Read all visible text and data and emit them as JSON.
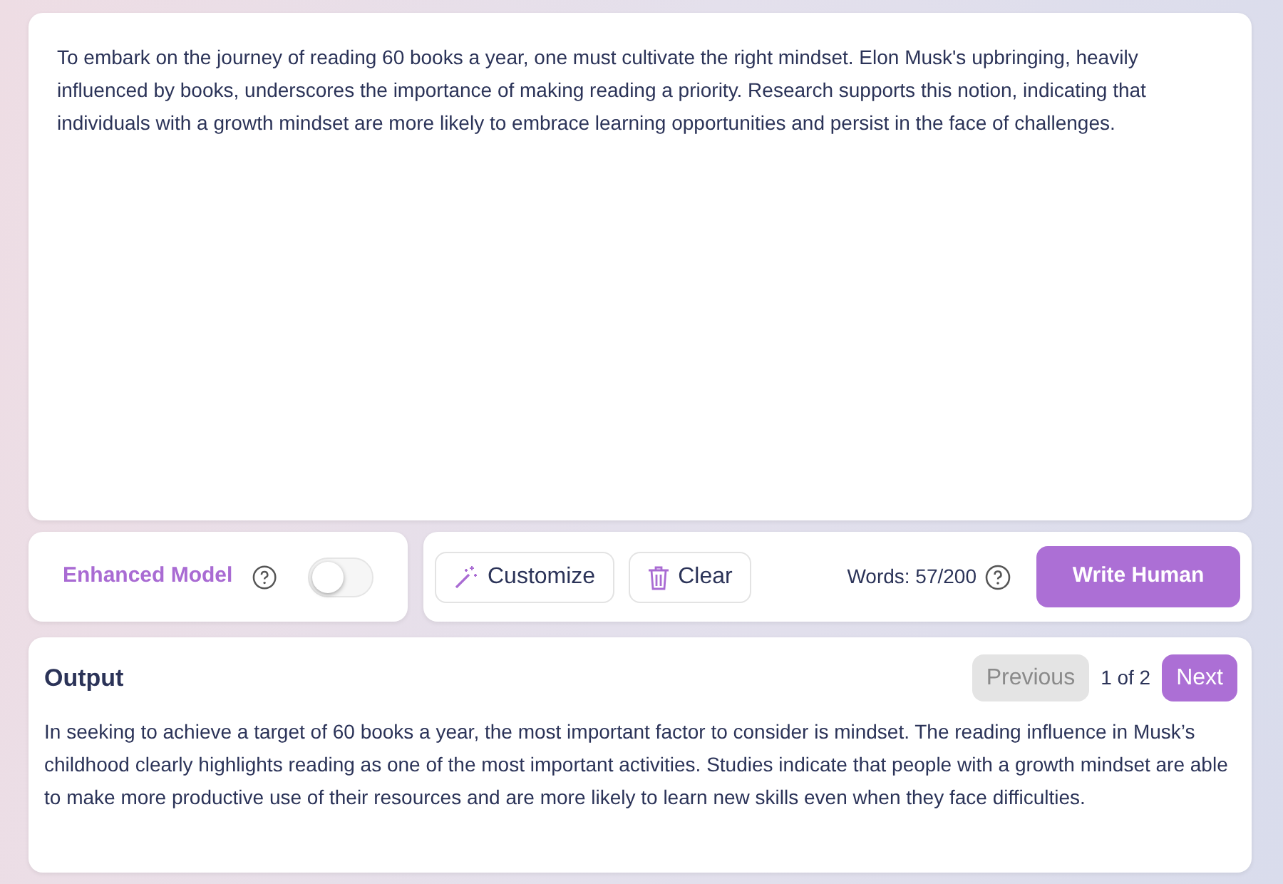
{
  "input": {
    "text": "To embark on the journey of reading 60 books a year, one must cultivate the right mindset. Elon Musk's upbringing, heavily influenced by books, underscores the importance of making reading a priority. Research supports this notion, indicating that individuals with a growth mindset are more likely to embrace learning opportunities and persist in the face of challenges."
  },
  "enhanced_model": {
    "label": "Enhanced Model",
    "on": false
  },
  "tools": {
    "customize": "Customize",
    "clear": "Clear",
    "word_count": "Words: 57/200",
    "submit": "Write Human"
  },
  "output": {
    "title": "Output",
    "previous": {
      "label": "Previous",
      "disabled": true
    },
    "page": "1 of 2",
    "next": {
      "label": "Next",
      "disabled": false
    },
    "text": "In seeking to achieve a target of 60 books a year, the most important factor to consider is mindset. The reading influence in Musk’s childhood clearly highlights reading as one of the most important activities. Studies indicate that people with a growth mindset are able to make more productive use of their resources and are more likely to learn new skills even when they face difficulties."
  }
}
